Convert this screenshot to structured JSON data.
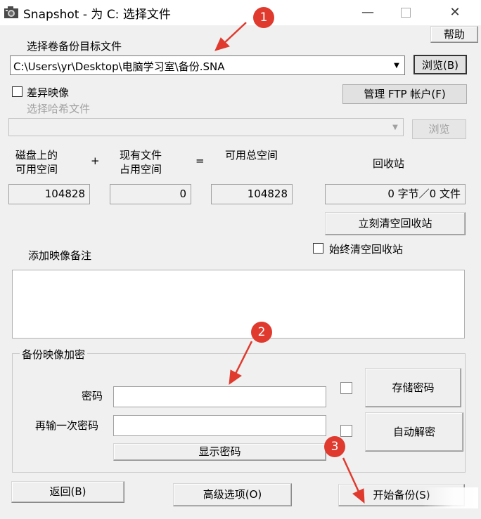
{
  "window": {
    "title": "Snapshot - 为 C: 选择文件",
    "minimize_icon": "minimize-icon",
    "maximize_icon": "maximize-icon",
    "close_icon": "close-icon"
  },
  "help_label": "帮助",
  "target": {
    "label": "选择卷备份目标文件",
    "path": "C:\\Users\\yr\\Desktop\\电脑学习室\\备份.SNA",
    "browse_label": "浏览(B)"
  },
  "differential": {
    "checkbox_label": "差异映像",
    "checked": false,
    "hash_label": "选择哈希文件",
    "hash_value": "",
    "hash_browse_label": "浏览"
  },
  "ftp_label": "管理 FTP 帐户(F)",
  "space": {
    "disk_free_label_1": "磁盘上的",
    "disk_free_label_2": "可用空间",
    "plus": "+",
    "existing_label_1": "现有文件",
    "existing_label_2": "占用空间",
    "equals": "=",
    "total_label": "可用总空间",
    "disk_free_value": "104828",
    "existing_value": "0",
    "total_value": "104828",
    "recycle_label": "回收站",
    "recycle_value": "0 字节／0 文件",
    "empty_recycle_label": "立刻清空回收站",
    "always_empty_label": "始终清空回收站",
    "always_empty_checked": false
  },
  "comment": {
    "label": "添加映像备注",
    "value": ""
  },
  "encryption": {
    "group_label": "备份映像加密",
    "password_label": "密码",
    "password_value": "",
    "repeat_label": "再输一次密码",
    "repeat_value": "",
    "show_password_label": "显示密码",
    "store_password_label": "存储密码",
    "auto_decrypt_label": "自动解密"
  },
  "footer": {
    "back_label": "返回(B)",
    "advanced_label": "高级选项(O)",
    "start_label": "开始备份(S)"
  },
  "annotations": {
    "badge_1": "1",
    "badge_2": "2",
    "badge_3": "3",
    "accent_color": "#e03a2e"
  }
}
